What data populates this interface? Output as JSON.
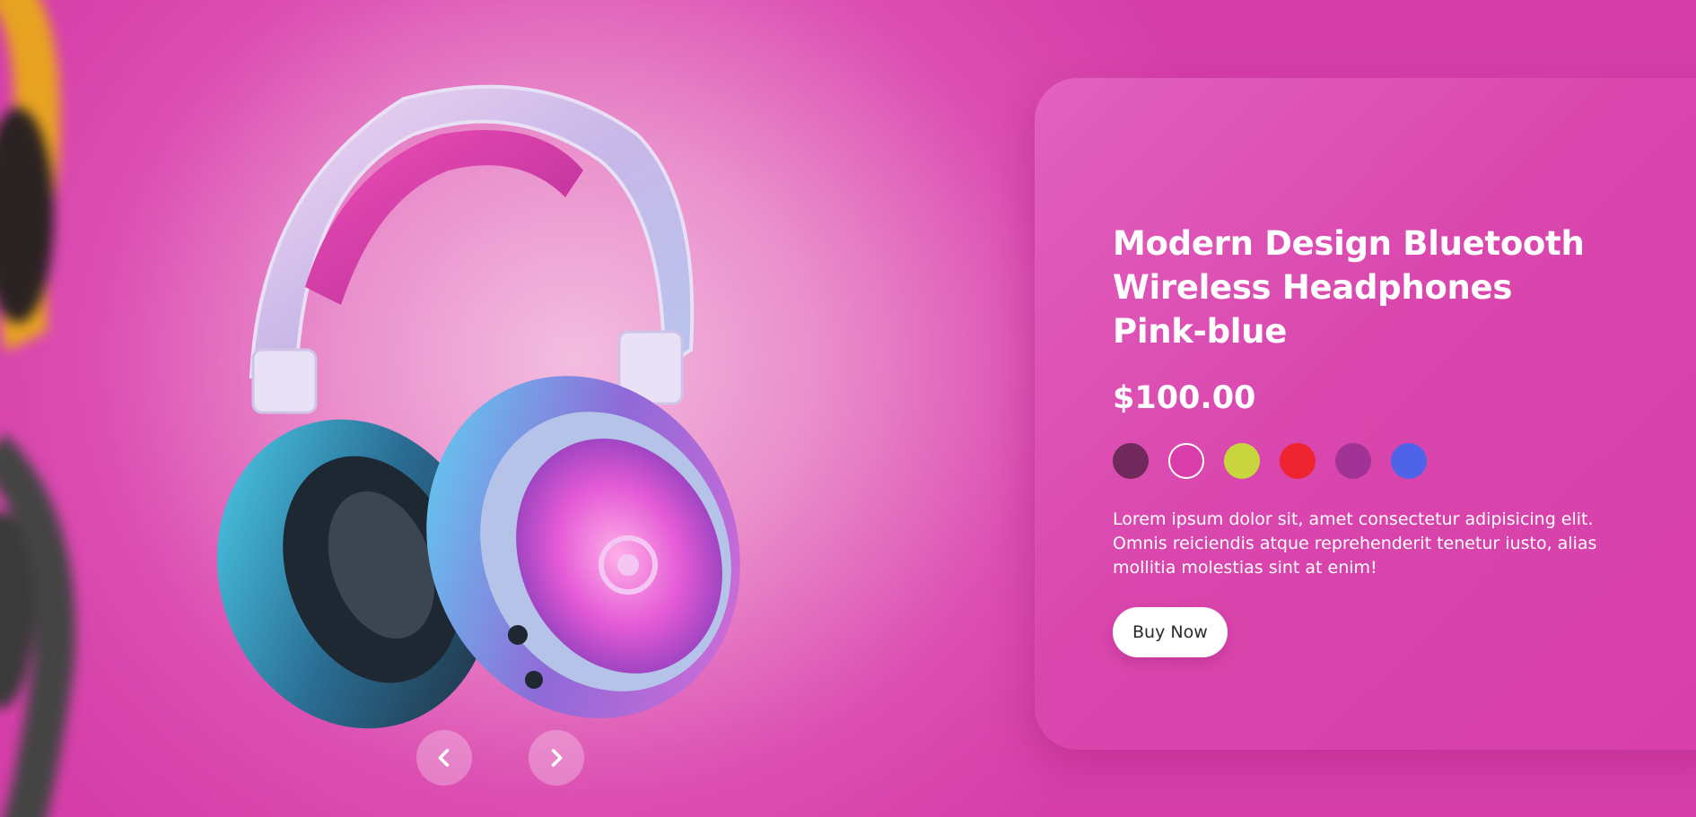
{
  "product": {
    "title_line1": "Modern Design Bluetooth",
    "title_line2": "Wireless Headphones Pink-blue",
    "price": "$100.00",
    "description": "Lorem ipsum dolor sit, amet consectetur adipisicing elit. Omnis reiciendis atque reprehenderit tenetur iusto, alias mollitia molestias sint at enim!",
    "buy_label": "Buy Now"
  },
  "colors": {
    "selected_index": 1,
    "swatches": [
      "#6f2a5b",
      "#d93da9",
      "#c7d63f",
      "#ee2430",
      "#a13397",
      "#4f63e8"
    ]
  },
  "navigation": {
    "prev_icon": "chevron-left-icon",
    "next_icon": "chevron-right-icon"
  },
  "theme": {
    "accent": "#d83ea9",
    "panel": "#dc4cb0"
  }
}
